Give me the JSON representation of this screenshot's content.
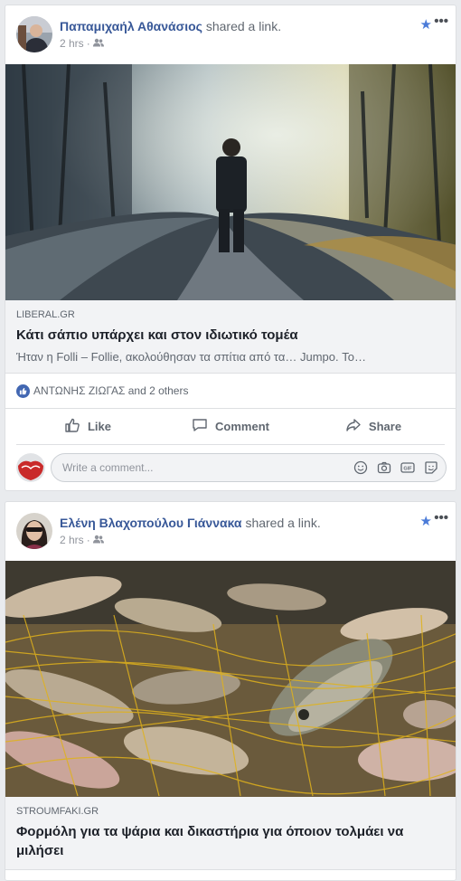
{
  "posts": [
    {
      "author": "Παπαμιχαήλ Αθανάσιος",
      "verb": "shared a link.",
      "time": "2 hrs",
      "link": {
        "domain": "LIBERAL.GR",
        "title": "Κάτι σάπιο υπάρχει και στον ιδιωτικό τομέα",
        "description": "Ήταν η Folli – Follie, ακολούθησαν τα σπίτια από τα… Jumpo. Το…"
      },
      "reactions": "ΑΝΤΩΝΗΣ ΖΙΩΓΑΣ and 2 others",
      "actions": {
        "like": "Like",
        "comment": "Comment",
        "share": "Share"
      },
      "comment_placeholder": "Write a comment..."
    },
    {
      "author": "Ελένη Βλαχοπούλου Γιάννακα",
      "verb": "shared a link.",
      "time": "2 hrs",
      "link": {
        "domain": "STROUMFAKI.GR",
        "title": "Φορμόλη για τα ψάρια και δικαστήρια για όποιον τολμάει να μιλήσει"
      }
    }
  ],
  "colors": {
    "name": "#385898",
    "star": "#4b7bd8",
    "like_badge": "#4267b2"
  }
}
